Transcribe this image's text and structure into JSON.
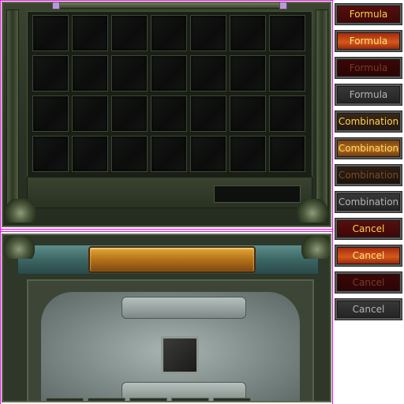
{
  "buttons": [
    {
      "label": "Formula",
      "state": "normal"
    },
    {
      "label": "Formula",
      "state": "hover"
    },
    {
      "label": "Formula",
      "state": "pressed"
    },
    {
      "label": "Formula",
      "state": "disabled"
    },
    {
      "label": "Combination",
      "state": "normal"
    },
    {
      "label": "Combination",
      "state": "hover"
    },
    {
      "label": "Combination",
      "state": "pressed"
    },
    {
      "label": "Combination",
      "state": "disabled"
    },
    {
      "label": "Cancel",
      "state": "normal"
    },
    {
      "label": "Cancel",
      "state": "hover"
    },
    {
      "label": "Cancel",
      "state": "pressed"
    },
    {
      "label": "Cancel",
      "state": "disabled"
    }
  ],
  "inventory": {
    "rows": 4,
    "columns": 7
  },
  "combination": {
    "material_slots": 5
  },
  "colors": {
    "guide": "#ff00ff",
    "frame_green": "#3a4430",
    "header_teal": "#3b6664",
    "title_gold": "#b9761b",
    "button_red": "#5a0f0f",
    "button_text_gold": "#ffd24a"
  }
}
